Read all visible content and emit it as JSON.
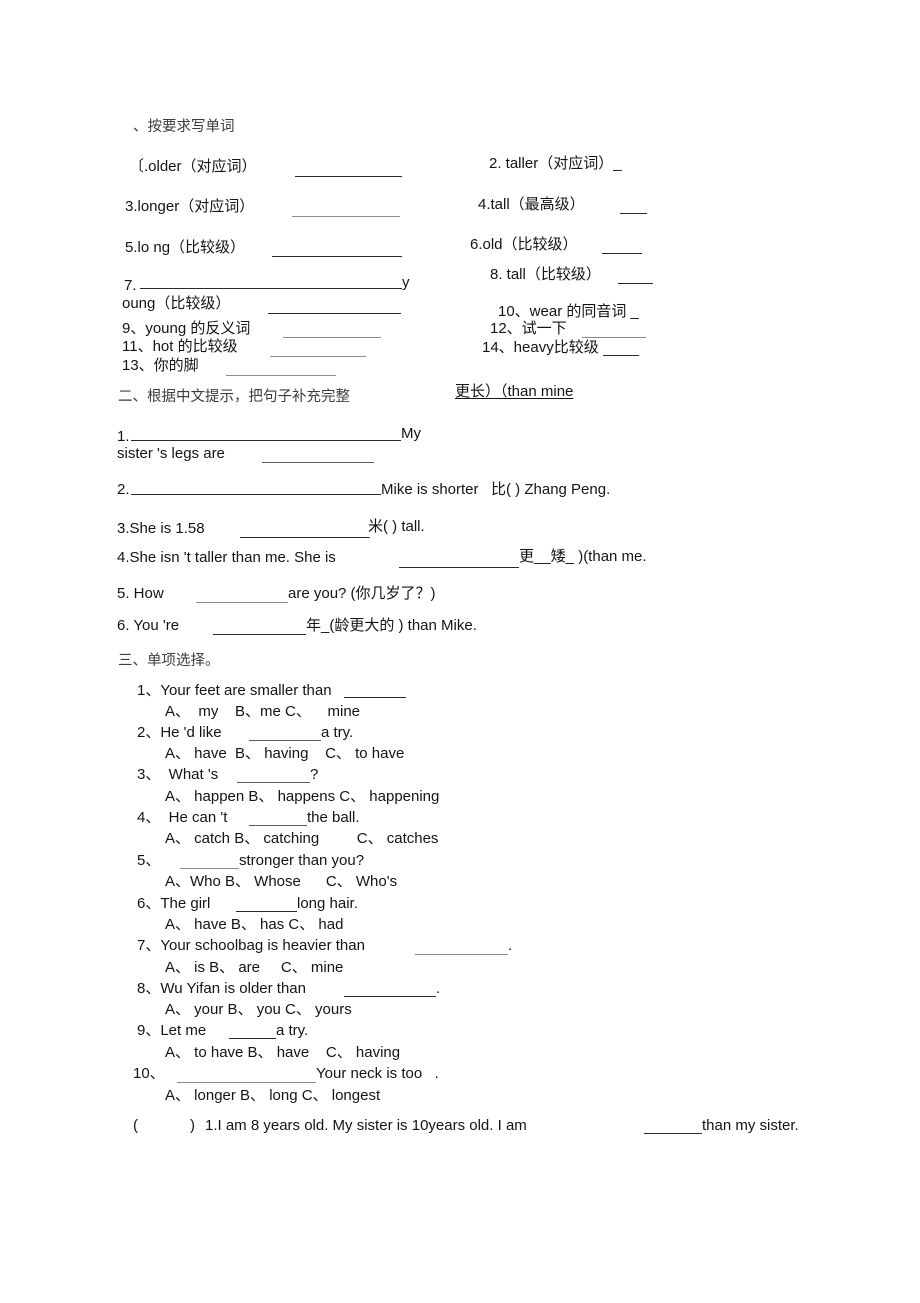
{
  "document": {
    "type": "worksheet",
    "language": "zh-CN/en",
    "sections": [
      {
        "heading": "、按要求写单词",
        "items": [
          {
            "num": "〔.",
            "text": "older（对应词）"
          },
          {
            "num": "2. ",
            "text": "taller（对应词）_"
          },
          {
            "num": "3.",
            "text": "longer（对应词）"
          },
          {
            "num": "4.",
            "text": "tall（最高级）"
          },
          {
            "num": "5.",
            "text": "lo ng（比较级）"
          },
          {
            "num": "6.",
            "text": "old（比较级）"
          },
          {
            "num": "7.",
            "text": "young（比较级）"
          },
          {
            "num": "8. ",
            "text": "tall（比较级）"
          },
          {
            "num": "9、",
            "text": "young 的反义词"
          },
          {
            "num": "10、",
            "text": "wear 的同音词 _"
          },
          {
            "num": "11、",
            "text": "hot 的比较级"
          },
          {
            "num": "12、",
            "text": "试一下"
          },
          {
            "num": "13、",
            "text": "你的脚"
          },
          {
            "num": "14、",
            "text": "heavy比较级"
          }
        ]
      },
      {
        "heading": "二、根据中文提示，把句子补充完整",
        "items": [
          {
            "num": "1.",
            "text": "My sister 's legs are",
            "hint": "更长）（than mine"
          },
          {
            "num": "2.",
            "text": "Mike is shorter",
            "hint": "比( ) Zhang Peng."
          },
          {
            "num": "3.",
            "text": "She is 1.58",
            "hint": "米( ) tall."
          },
          {
            "num": "4.",
            "text": "She isn 't taller than me. She is",
            "hint": "更__矮_ )(than me."
          },
          {
            "num": "5. ",
            "text": "How",
            "hint": "are you? (你几岁了？)"
          },
          {
            "num": "6. ",
            "text": "You 're",
            "hint": "年_(龄更大的 ) than Mike."
          }
        ]
      },
      {
        "heading": "三、单项选择。",
        "items": [
          {
            "num": "1、",
            "stem": "Your feet are smaller than",
            "options": "A、 my   B、me C、   mine"
          },
          {
            "num": "2、",
            "stem": "He 'd like ________a try.",
            "options": "A、 have B、 having   C、 to have"
          },
          {
            "num": "3、",
            "stem": " What 's __________?",
            "options": "A、 happen B、 happens C、 happening"
          },
          {
            "num": "4、",
            "stem": " He can 't _______the ball.",
            "options": "A、 catch B、 catching       C、 catches"
          },
          {
            "num": "5、",
            "stem": "  ________stronger than you?",
            "options": "A、Who B、 Whose     C、 Who's"
          },
          {
            "num": "6、",
            "stem": "The girl _______long hair.",
            "options": "A、 have B、 has C、 had"
          },
          {
            "num": "7、",
            "stem": "Your schoolbag is heavier than __________.",
            "options": "A、 is B、 are    C、 mine"
          },
          {
            "num": "8、",
            "stem": "Wu Yifan is older than __________.",
            "options": "A、 your B、 you C、 yours"
          },
          {
            "num": "9、",
            "stem": "Let me ______a try.",
            "options": "A、 to have B、 have    C、 having"
          },
          {
            "num": "10、",
            "stem": "__________________Your neck is too  .",
            "options": "A、 longer B、 long C、 longest"
          }
        ]
      },
      {
        "heading": "",
        "items": [
          {
            "num": "(        )",
            "text": "1.I am 8 years old. My sister is 10years old. I am ______than my sister."
          }
        ]
      }
    ]
  },
  "text": {
    "s1_heading": "、按要求写单词",
    "q1": "〔.older（对应词）",
    "q2": "2. taller（对应词）_",
    "q3": "3.longer（对应词）",
    "q4": "4.tall（最高级）",
    "q5": "5.lo ng（比较级）",
    "q6": "6.old（比较级）",
    "q7_a": "7.",
    "q7_b": "y",
    "q7_c": "oung（比较级）",
    "q8": "8. tall（比较级）",
    "q9": "9、young 的反义词",
    "q10": "10、wear 的同音词 _",
    "q11": "11、hot 的比较级",
    "q12": "12、试一下",
    "q13": "13、你的脚",
    "q14": "14、heavy比较级",
    "s2_heading": "二、根据中文提示，把句子补充完整",
    "s2_hint1": "更长）（than mine",
    "s2_q1a": "1.",
    "s2_q1b": "My",
    "s2_q1c": "sister 's legs are",
    "s2_q2a": "2.",
    "s2_q2b": "Mike is shorter   比( ) Zhang Peng.",
    "s2_q3a": "3.She is 1.58",
    "s2_q3b": "米( ) tall.",
    "s2_q4a": "4.She isn 't taller than me. She is",
    "s2_q4b": "更__矮_ )(than me.",
    "s2_q5a": "5. How",
    "s2_q5b": "are you? (你几岁了？)",
    "s2_q6a": "6. You 're",
    "s2_q6b": "年_(龄更大的 ) than Mike.",
    "s3_heading": "三、单项选择。",
    "s3_q1": "1、Your feet are smaller than",
    "s3_a1": "A、  my    B、me C、    mine",
    "s3_q2": "2、He 'd like",
    "s3_q2b": "a try.",
    "s3_a2": "A、 have  B、 having    C、 to have",
    "s3_q3": "3、  What 's",
    "s3_q3b": "?",
    "s3_a3": "A、 happen B、 happens C、 happening",
    "s3_q4": "4、  He can 't",
    "s3_q4b": "the ball.",
    "s3_a4": "A、 catch B、 catching         C、 catches",
    "s3_q5": "5、",
    "s3_q5b": "stronger than you?",
    "s3_a5": "A、Who B、 Whose      C、 Who's",
    "s3_q6": "6、The girl",
    "s3_q6b": "long hair.",
    "s3_a6": "A、 have B、 has C、 had",
    "s3_q7": "7、Your schoolbag is heavier than",
    "s3_q7b": ".",
    "s3_a7": "A、 is B、 are     C、 mine",
    "s3_q8": "8、Wu Yifan is older than",
    "s3_q8b": ".",
    "s3_a8": "A、 your B、 you C、 yours",
    "s3_q9": "9、Let me",
    "s3_q9b": "a try.",
    "s3_a9": "A、 to have B、 have    C、 having",
    "s3_q10": "10、",
    "s3_q10b": "Your neck is too   .",
    "s3_a10": "A、 longer B、 long C、 longest",
    "s4_mark": "(",
    "s4_mark_close": ")",
    "s4_q1a": "1.I am 8 years old. My sister is 10years old. I am",
    "s4_q1b": "than my sister."
  }
}
